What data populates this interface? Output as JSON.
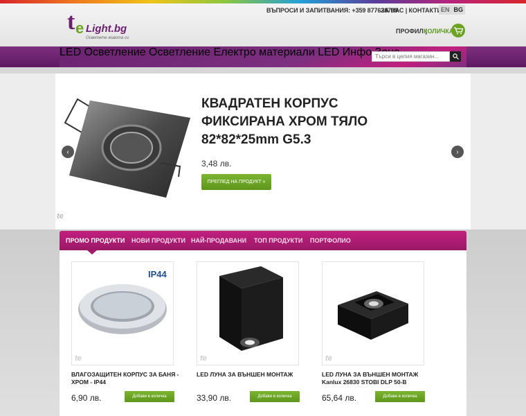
{
  "brand": {
    "logo_mark": "te",
    "logo_text": "Light.bg",
    "tagline": "Осветете живота си"
  },
  "topbar": {
    "contact": "ВЪПРОСИ И ЗАПИТВАНИЯ: +359 877628709",
    "about_contacts": "ЗА НАС | КОНТАКТИ",
    "lang_en": "EN",
    "lang_bg": "BG",
    "profile": "ПРОФИЛ |",
    "cart": "КОЛИЧКА",
    "cart_icon": "cart-icon"
  },
  "nav": {
    "items": [
      "LED Осветление",
      "Осветление",
      "Електро материали",
      "LED Инфо Зона"
    ],
    "search_placeholder": "Търси в целия магазин..."
  },
  "slider": {
    "title": "КВАДРАТЕН КОРПУС ФИКСИРАНА ХРОМ ТЯЛО 82*82*25mm G5.3",
    "price": "3,48 лв.",
    "button": "ПРЕГЛЕД НА ПРОДУКТ »",
    "prev": "‹",
    "next": "›",
    "watermark": "te"
  },
  "tabs": [
    "ПРОМО ПРОДУКТИ",
    "НОВИ ПРОДУКТИ",
    "НАЙ-ПРОДАВАНИ",
    "ТОП ПРОДУКТИ",
    "ПОРТФОЛИО"
  ],
  "products": [
    {
      "title": "ВЛАГОЗАЩИТЕН КОРПУС ЗА БАНЯ - ХРОМ - IP44",
      "price": "6,90 лв.",
      "button": "Добави в количка",
      "badge": "IP44",
      "watermark": "te"
    },
    {
      "title": "LED ЛУНА ЗА ВЪНШЕН МОНТАЖ",
      "price": "33,90 лв.",
      "button": "Добави в количка",
      "watermark": "te"
    },
    {
      "title": "LED ЛУНА ЗА ВЪНШЕН МОНТАЖ Kanlux 26830 STOBI DLP 50-B",
      "price": "65,64 лв.",
      "button": "Добави в количка",
      "watermark": "te"
    }
  ],
  "colors": {
    "accent_purple": "#7d2f80",
    "accent_magenta": "#c21f7e",
    "accent_green": "#6ba424"
  }
}
